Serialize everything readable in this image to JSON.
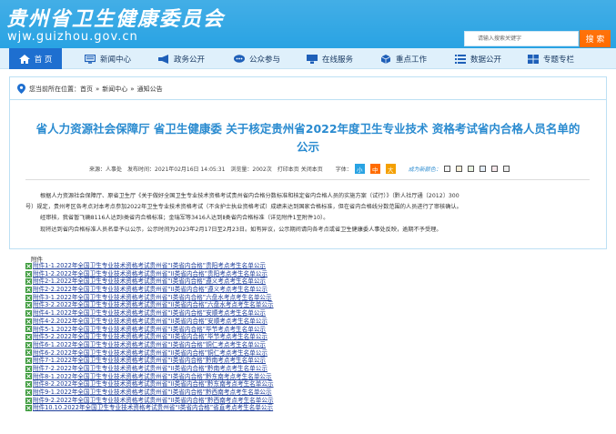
{
  "header": {
    "title": "贵州省卫生健康委员会",
    "url": "wjw.guizhou.gov.cn",
    "search_placeholder": "请输入搜索关键字",
    "search_button": "搜 索",
    "colors": {
      "header_bg": "#29a3e3",
      "search_button_bg": "#ff6c00"
    }
  },
  "nav": {
    "items": [
      {
        "label": "首 页",
        "icon": "home-icon",
        "active": true
      },
      {
        "label": "新闻中心",
        "icon": "monitor-icon"
      },
      {
        "label": "政务公开",
        "icon": "megaphone-icon"
      },
      {
        "label": "公众参与",
        "icon": "chat-icon"
      },
      {
        "label": "在线服务",
        "icon": "computer-icon"
      },
      {
        "label": "重点工作",
        "icon": "cube-icon"
      },
      {
        "label": "数据公开",
        "icon": "list-icon"
      },
      {
        "label": "专题专栏",
        "icon": "grid-icon"
      }
    ],
    "colors": {
      "nav_bg": "#dff0fb",
      "active_bg": "#1e6fd0"
    }
  },
  "breadcrumb": {
    "prefix": "您当前所在位置：",
    "items": [
      "首页",
      "新闻中心",
      "通知公告"
    ],
    "separator": "»"
  },
  "article": {
    "title_line1": "省人力资源社会保障厅 省卫生健康委 关于核定贵州省2022年度卫生专业技术 资格考试省内合格人员名单的",
    "title_line2": "公示",
    "meta": {
      "source": "来源：人事处",
      "published": "发布时间：2021年02月16日 14:05:31",
      "views": "浏览量：2002次",
      "print": "打印本页",
      "close": "关闭本页",
      "font_label": "字体：",
      "font_small": "小",
      "font_mid": "中",
      "font_big": "大",
      "color_label": "成为新颜色："
    },
    "paragraphs": [
      "根据人力资源社会保障厅、原省卫生厅《关于做好全国卫生专业技术资格考试贵州省内合格分数标准和核定省内合格人员的实施方案（试行）》（黔人社厅通〔2012〕300",
      "号）规定，贵州考区各考点对本考点参加2022年卫生专业技术资格考试（不含护士执业资格考试）成绩未达到国家合格标准，但在省内合格线分数范围的人员进行了审核确认。",
      "经审核，我省暂飞确8116人达到Ⅰ类省内合格标准；金瑞军等3416人达到Ⅱ类省内合格标准（详见附件1至附件10）。",
      "现将达到省内合格标准人员名单予以公示，公示时间为2023年2月17日至2月23日。如有异议，公示期间请向各考点或省卫生健康委人事处反映，逾期不予受理。"
    ]
  },
  "attachments": {
    "label": "附件",
    "items": [
      "附件1-1.2022年全国卫生专业技术资格考试贵州省“I类省内合格”贵阳考点考生名单公示",
      "附件1-2.2022年全国卫生专业技术资格考试贵州省“II类省内合格”贵阳考点考生名单公示",
      "附件2-1.2022年全国卫生专业技术资格考试贵州省“I类省内合格”遵义考点考生名单公示",
      "附件2-2.2022年全国卫生专业技术资格考试贵州省“II类省内合格”遵义考点考生名单公示",
      "附件3-1.2022年全国卫生专业技术资格考试贵州省“I类省内合格”六盘水考点考生名单公示",
      "附件3-2.2022年全国卫生专业技术资格考试贵州省“II类省内合格”六盘水考点考生名单公示",
      "附件4-1.2022年全国卫生专业技术资格考试贵州省“I类省内合格”安顺考点考生名单公示",
      "附件4-2.2022年全国卫生专业技术资格考试贵州省“II类省内合格”安顺考点考生名单公示",
      "附件5-1.2022年全国卫生专业技术资格考试贵州省“I类省内合格”毕节考点考生名单公示",
      "附件5-2.2022年全国卫生专业技术资格考试贵州省“II类省内合格”毕节考点考生名单公示",
      "附件6-1.2022年全国卫生专业技术资格考试贵州省“I类省内合格”铜仁考点考生名单公示",
      "附件6-2.2022年全国卫生专业技术资格考试贵州省“II类省内合格”铜仁考点考生名单公示",
      "附件7-1.2022年全国卫生专业技术资格考试贵州省“I类省内合格”黔南考点考生名单公示",
      "附件7-2.2022年全国卫生专业技术资格考试贵州省“II类省内合格”黔南考点考生名单公示",
      "附件8-1.2022年全国卫生专业技术资格考试贵州省“I类省内合格”黔东南考点考生名单公示",
      "附件8-2.2022年全国卫生专业技术资格考试贵州省“II类省内合格”黔东南考点考生名单公示",
      "附件9-1.2022年全国卫生专业技术资格考试贵州省“I类省内合格”黔西南考点考生名单公示",
      "附件9-2.2022年全国卫生专业技术资格考试贵州省“II类省内合格”黔西南考点考生名单公示",
      "附件10.10.2022年全国卫生专业技术资格考试贵州省“I类省内合格”省直考点考生名单公示"
    ],
    "colors": {
      "link": "#1d3d9a",
      "icon": "#3a9a3a"
    }
  }
}
